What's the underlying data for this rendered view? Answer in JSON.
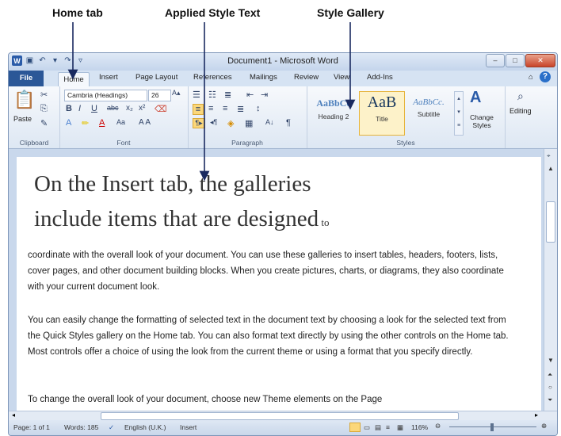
{
  "annotations": {
    "home_tab": "Home  tab",
    "applied_style": "Applied Style Text",
    "style_gallery": "Style Gallery"
  },
  "window": {
    "title": "Document1 - Microsoft Word",
    "min": "–",
    "max": "□",
    "close": "✕"
  },
  "tabs": [
    "File",
    "Home",
    "Insert",
    "Page Layout",
    "References",
    "Mailings",
    "Review",
    "View",
    "Add-Ins"
  ],
  "ribbon": {
    "clipboard": {
      "label": "Clipboard",
      "paste": "Paste"
    },
    "font": {
      "label": "Font",
      "name": "Cambria (Headings)",
      "size": "26"
    },
    "paragraph": {
      "label": "Paragraph"
    },
    "styles": {
      "label": "Styles",
      "items": [
        {
          "sample": "AaBbCc",
          "name": "Heading 2"
        },
        {
          "sample": "AaB",
          "name": "Title"
        },
        {
          "sample": "AaBbCc.",
          "name": "Subtitle"
        }
      ],
      "change_styles": "Change Styles"
    },
    "editing": {
      "label": "Editing"
    }
  },
  "document": {
    "heading_line1": "On the Insert tab, the galleries",
    "heading_line2": "include items that are designed",
    "heading_tail": " to",
    "para1": "coordinate with the overall look of your document. You can use these galleries to insert tables, headers, footers, lists, cover pages, and other document building blocks. When you create pictures, charts, or diagrams, they also coordinate with your current document look.",
    "para2": "You can easily change the formatting of selected text in the document text by choosing a look for the selected text from the Quick Styles gallery on the Home tab. You can also format text directly by using the other controls on the Home tab. Most controls offer a choice of using the look from the current theme or using a format that you specify directly.",
    "para3": "To change the overall look of your document, choose new Theme elements on the Page"
  },
  "status": {
    "page": "Page: 1 of 1",
    "words": "Words: 185",
    "language": "English (U.K.)",
    "mode": "Insert",
    "zoom": "116%"
  }
}
